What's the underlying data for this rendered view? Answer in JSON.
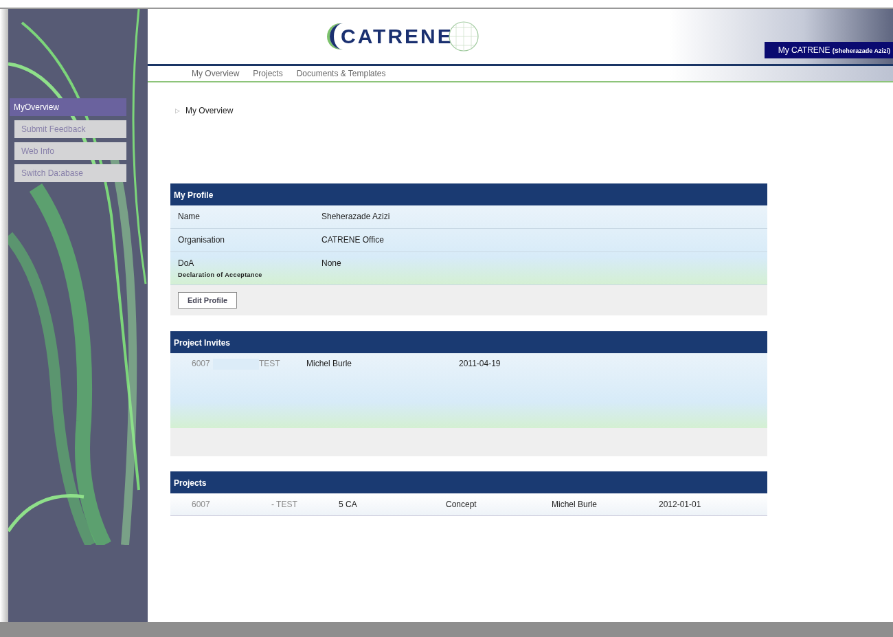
{
  "header": {
    "logo": "CATRENE",
    "user_badge": {
      "label": "My CATRENE",
      "user": "(Sheherazade Azizi)"
    }
  },
  "nav": [
    {
      "label": "My Overview"
    },
    {
      "label": "Projects"
    },
    {
      "label": "Documents & Templates"
    }
  ],
  "sidebar": {
    "title": "MyOverview",
    "items": [
      "Submit Feedback",
      "Web Info",
      "Switch Da:abase"
    ]
  },
  "breadcrumb": {
    "marker": "▷",
    "label": "My Overview"
  },
  "profile": {
    "title": "My Profile",
    "rows": [
      {
        "label": "Name",
        "value": "Sheherazade Azizi"
      },
      {
        "label": "Organisation",
        "value": "CATRENE Office"
      },
      {
        "label": "DoA",
        "sublabel": "Declaration of Acceptance",
        "value": "None"
      }
    ],
    "button": "Edit Profile"
  },
  "invites": {
    "title": "Project Invites",
    "rows": [
      {
        "cells": [
          {
            "text": "6007",
            "muted": true
          },
          {
            "text": "TEST",
            "muted": true
          },
          {
            "text": "Michel Burle",
            "muted": false
          },
          {
            "text": "2011-04-19",
            "muted": false
          }
        ]
      }
    ]
  },
  "projects": {
    "title": "Projects",
    "rows": [
      {
        "cells": [
          {
            "text": "6007",
            "muted": true
          },
          {
            "text": "- TEST",
            "muted": true
          },
          {
            "text": "5 CA",
            "muted": false
          },
          {
            "text": "Concept",
            "muted": false
          },
          {
            "text": "Michel Burle",
            "muted": false
          },
          {
            "text": "2012-01-01",
            "muted": false
          }
        ]
      }
    ]
  }
}
